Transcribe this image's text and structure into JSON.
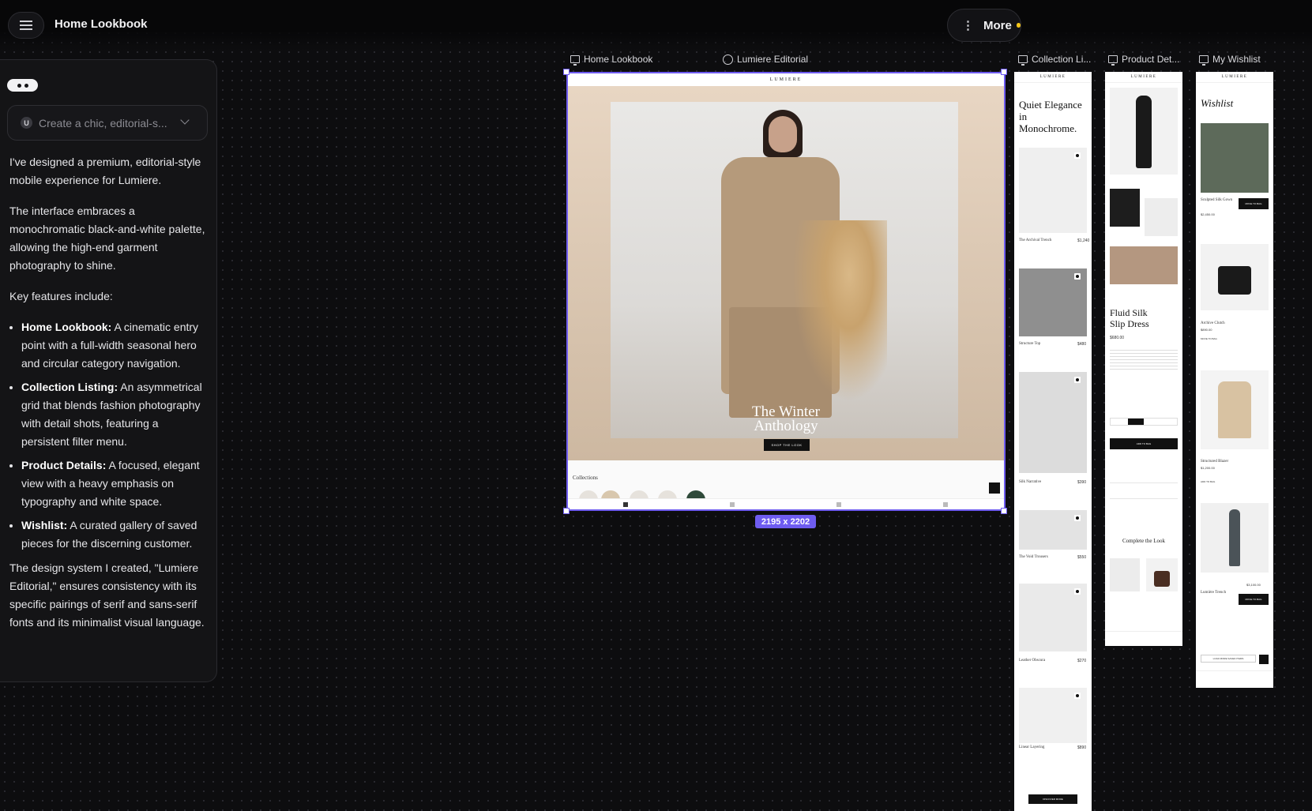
{
  "topbar": {
    "title": "Home Lookbook",
    "more_label": "More"
  },
  "chat": {
    "prompt_initial": "U",
    "prompt_placeholder": "Create a chic, editorial-s...",
    "intro": "I've designed a premium, editorial-style mobile experience for Lumiere.",
    "palette": "The interface embraces a monochromatic black-and-white palette, allowing the high-end garment photography to shine.",
    "features_heading": "Key features include:",
    "features": [
      {
        "name": "Home Lookbook:",
        "text": " A cinematic entry point with a full-width seasonal hero and circular category navigation."
      },
      {
        "name": "Collection Listing:",
        "text": " An asymmetrical grid that blends fashion photography with detail shots, featuring a persistent filter menu."
      },
      {
        "name": "Product Details:",
        "text": " A focused, elegant view with a heavy emphasis on typography and white space."
      },
      {
        "name": "Wishlist:",
        "text": " A curated gallery of saved pieces for the discerning customer."
      }
    ],
    "closing": "The design system I created, \"Lumiere Editorial,\" ensures consistency with its specific pairings of serif and sans-serif fonts and its minimalist visual language."
  },
  "frames": {
    "labels": [
      "Home Lookbook",
      "Lumiere Editorial",
      "Collection Li...",
      "Product Det...",
      "My Wishlist"
    ],
    "size_badge": "2195 x 2202"
  },
  "home": {
    "brand": "LUMIERE",
    "hero_title_1": "The Winter",
    "hero_title_2": "Anthology",
    "hero_button": "SHOP THE LOOK",
    "collections_title": "Collections"
  },
  "collection": {
    "brand": "LUMIERE",
    "headline": [
      "Quiet Elegance",
      "in",
      "Monochrome."
    ],
    "items": [
      {
        "name": "The Archival Trench",
        "price": "$1,240"
      },
      {
        "name": "Structure Top",
        "price": "$480"
      },
      {
        "name": "Silk Narrative",
        "price": "$390"
      },
      {
        "name": "The Void Trousers",
        "price": "$550"
      },
      {
        "name": "Leather Obscura",
        "price": "$270"
      },
      {
        "name": "Linear Layering",
        "price": "$890"
      }
    ],
    "cta": "DISCOVER MORE"
  },
  "product": {
    "brand": "LUMIERE",
    "title_1": "Fluid Silk",
    "title_2": "Slip Dress",
    "price": "$680.00",
    "add_to_bag": "ADD TO BAG",
    "complete_look": "Complete the Look"
  },
  "wishlist": {
    "brand": "LUMIERE",
    "title": "Wishlist",
    "items": [
      {
        "name": "Sculpted Silk Gown",
        "price": "$2,450.00",
        "action": "MOVE TO BAG"
      },
      {
        "name": "Archive Clutch",
        "price": "$890.00",
        "action": "MOVE TO BAG"
      },
      {
        "name": "Structured Blazer",
        "price": "$1,200.00",
        "action": "ADD TO BAG"
      },
      {
        "name": "Lumière Trench",
        "price": "$3,100.00",
        "action": "MOVE TO BAG"
      }
    ],
    "load_more": "LOAD MORE SAVED ITEMS"
  }
}
